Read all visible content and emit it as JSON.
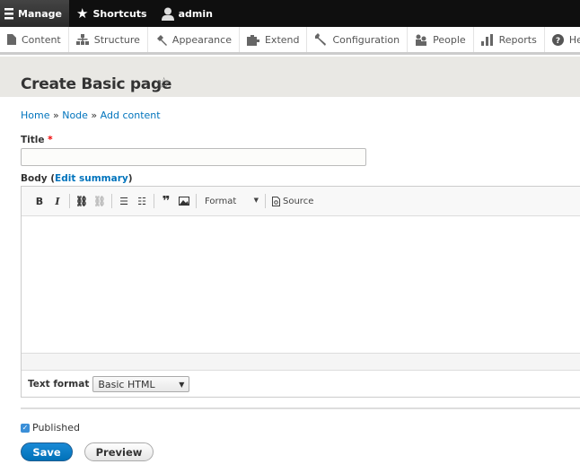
{
  "toolbar": {
    "manage": "Manage",
    "shortcuts": "Shortcuts",
    "user": "admin"
  },
  "tray": [
    {
      "label": "Content",
      "icon": "file-icon"
    },
    {
      "label": "Structure",
      "icon": "sitemap-icon"
    },
    {
      "label": "Appearance",
      "icon": "brush-icon"
    },
    {
      "label": "Extend",
      "icon": "puzzle-icon"
    },
    {
      "label": "Configuration",
      "icon": "wrench-icon"
    },
    {
      "label": "People",
      "icon": "people-icon"
    },
    {
      "label": "Reports",
      "icon": "bar-chart-icon"
    },
    {
      "label": "Help",
      "icon": "help-icon"
    }
  ],
  "page": {
    "title": "Create Basic page"
  },
  "breadcrumb": {
    "home": "Home",
    "sep1": " » ",
    "node": "Node",
    "sep2": " » ",
    "add": "Add content"
  },
  "form": {
    "title_label": "Title",
    "required_mark": "*",
    "title_value": "",
    "body_label": "Body (",
    "edit_summary": "Edit summary",
    "body_close": ")",
    "editor": {
      "bold": "B",
      "italic": "I",
      "format": "Format",
      "source": "Source"
    },
    "text_format_label": "Text format",
    "text_format_value": "Basic HTML",
    "published_label": "Published",
    "published": true,
    "save": "Save",
    "preview": "Preview"
  },
  "colors": {
    "accent": "#0074bd",
    "save_button": "#0071b8",
    "required": "#e00"
  }
}
